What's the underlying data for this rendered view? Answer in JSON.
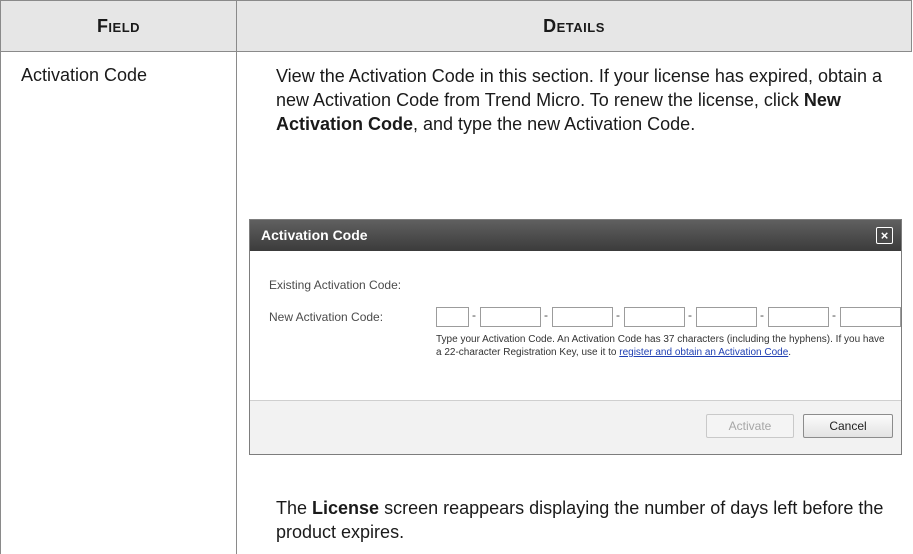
{
  "table": {
    "headers": {
      "field": "Field",
      "details": "Details"
    },
    "row": {
      "field": "Activation Code",
      "intro": {
        "text_1": "View the Activation Code in this section. If your license has expired, obtain a new Activation Code from Trend Micro. To renew the license, click ",
        "bold": "New Activation Code",
        "text_2": ", and type the new Activation Code."
      },
      "outro": {
        "text_1": "The ",
        "bold": "License",
        "text_2": " screen reappears displaying the number of days left before the product expires."
      }
    }
  },
  "dialog": {
    "title": "Activation Code",
    "close_glyph": "×",
    "existing_label": "Existing Activation Code:",
    "new_label": "New Activation Code:",
    "dash": "-",
    "help_text": "Type your Activation Code. An Activation Code has 37 characters (including the hyphens). If you have a 22-character Registration Key, use it to ",
    "help_link": "register and obtain an Activation Code",
    "help_end": ".",
    "activate_label": "Activate",
    "cancel_label": "Cancel"
  }
}
